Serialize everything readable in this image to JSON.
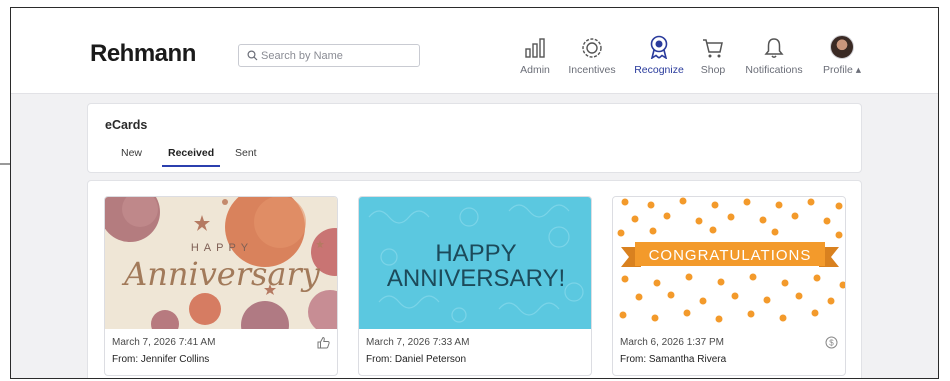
{
  "header": {
    "logo": "Rehmann",
    "search_placeholder": "Search by Name",
    "nav": [
      {
        "label": "Admin",
        "icon": "bar-chart-icon"
      },
      {
        "label": "Incentives",
        "icon": "badge-icon"
      },
      {
        "label": "Recognize",
        "icon": "award-ribbon-icon",
        "active": true
      },
      {
        "label": "Shop",
        "icon": "cart-icon"
      },
      {
        "label": "Notifications",
        "icon": "bell-icon"
      },
      {
        "label": "Profile ▴",
        "icon": "avatar"
      }
    ]
  },
  "ecards": {
    "title": "eCards",
    "tabs": [
      "New",
      "Received",
      "Sent"
    ],
    "active_tab": "Received"
  },
  "cards": [
    {
      "image_top_text": "HAPPY",
      "image_script_text": "Anniversary",
      "date": "March 7, 2026 7:41 AM",
      "from": "From: Jennifer Collins",
      "corner_icon": "thumbs-up-icon"
    },
    {
      "image_line1": "HAPPY",
      "image_line2": "ANNIVERSARY!",
      "date": "March 7, 2026 7:33 AM",
      "from": "From: Daniel Peterson",
      "corner_icon": ""
    },
    {
      "image_banner_text": "CONGRATULATIONS",
      "date": "March 6, 2026 1:37 PM",
      "from": "From: Samantha Rivera",
      "corner_icon": "dollar-circle-icon"
    }
  ],
  "colors": {
    "accent": "#2b3fae",
    "orange": "#f39a2b",
    "sky": "#5bc8e0"
  }
}
